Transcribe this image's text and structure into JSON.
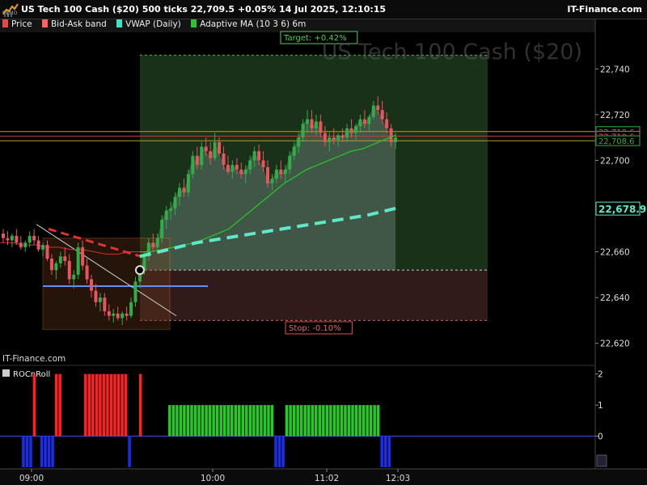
{
  "header": {
    "title": "US Tech 100 Cash ($20) 500 ticks 22,709.5 +0.05% 14 Jul 2025, 12:10:15",
    "brand": "IT-Finance.com",
    "logo_sub": "DEMO"
  },
  "legend": [
    {
      "label": "Price",
      "color": "#e24a4a"
    },
    {
      "label": "Bid-Ask band",
      "color": "#ff6060"
    },
    {
      "label": "VWAP (Daily)",
      "color": "#40e0c0"
    },
    {
      "label": "Adaptive MA (10 3 6) 6m",
      "color": "#30c030"
    }
  ],
  "watermark": "US Tech 100 Cash ($20)",
  "footer_brand": "IT-Finance.com",
  "target_label": "Target: +0.42%",
  "stop_label": "Stop: -0.10%",
  "colors": {
    "up": "#2fae47",
    "down": "#e85560",
    "vwap": "#5ee8c8",
    "ama": "#22cc22",
    "band": "#d0b030",
    "ema": "#e03030",
    "panel": "#ff2020",
    "pos": "#22cc22",
    "neg": "#1a2de8"
  },
  "chart_data": [
    {
      "type": "candlestick",
      "yaxis": {
        "ticks": [
          22740,
          22720,
          22700,
          22680,
          22660,
          22640,
          22620
        ],
        "labels": [
          "22,740",
          "22,720",
          "22,700",
          "22,680",
          "22,660",
          "22,640",
          "22,620"
        ],
        "ylim": [
          22616,
          22756
        ]
      },
      "xaxis": {
        "labels": [
          "09:00",
          "10:00",
          "11:02",
          "12:03"
        ]
      },
      "price_tags": [
        {
          "label": "22,712.6",
          "value": 22712.6,
          "color": "#2fae47"
        },
        {
          "label": "22,710.6",
          "value": 22710.6,
          "color": "#e85560"
        },
        {
          "label": "22,708.6",
          "value": 22708.6,
          "color": "#2fae47"
        },
        {
          "label": "22,678.9",
          "value": 22678.9,
          "color": "#5ee8c8"
        }
      ],
      "candles": [
        [
          22668,
          22670,
          22664,
          22666
        ],
        [
          22666,
          22669,
          22663,
          22665
        ],
        [
          22665,
          22668,
          22662,
          22667
        ],
        [
          22667,
          22670,
          22663,
          22664
        ],
        [
          22664,
          22667,
          22661,
          22662
        ],
        [
          22662,
          22665,
          22660,
          22664
        ],
        [
          22664,
          22669,
          22662,
          22667
        ],
        [
          22667,
          22670,
          22663,
          22665
        ],
        [
          22665,
          22667,
          22660,
          22661
        ],
        [
          22661,
          22664,
          22658,
          22663
        ],
        [
          22663,
          22665,
          22656,
          22657
        ],
        [
          22657,
          22659,
          22650,
          22652
        ],
        [
          22652,
          22656,
          22648,
          22655
        ],
        [
          22655,
          22660,
          22653,
          22658
        ],
        [
          22658,
          22662,
          22654,
          22656
        ],
        [
          22656,
          22659,
          22646,
          22648
        ],
        [
          22648,
          22652,
          22644,
          22650
        ],
        [
          22650,
          22664,
          22648,
          22662
        ],
        [
          22662,
          22665,
          22652,
          22654
        ],
        [
          22654,
          22657,
          22646,
          22648
        ],
        [
          22648,
          22650,
          22640,
          22643
        ],
        [
          22643,
          22646,
          22636,
          22638
        ],
        [
          22638,
          22642,
          22634,
          22640
        ],
        [
          22640,
          22642,
          22632,
          22634
        ],
        [
          22634,
          22637,
          22630,
          22632
        ],
        [
          22632,
          22635,
          22629,
          22633
        ],
        [
          22633,
          22636,
          22630,
          22631
        ],
        [
          22631,
          22634,
          22628,
          22633
        ],
        [
          22633,
          22636,
          22630,
          22632
        ],
        [
          22632,
          22640,
          22631,
          22638
        ],
        [
          22638,
          22649,
          22636,
          22647
        ],
        [
          22647,
          22654,
          22644,
          22652
        ],
        [
          22652,
          22660,
          22650,
          22658
        ],
        [
          22658,
          22666,
          22656,
          22664
        ],
        [
          22664,
          22668,
          22660,
          22662
        ],
        [
          22662,
          22668,
          22660,
          22666
        ],
        [
          22666,
          22676,
          22664,
          22674
        ],
        [
          22674,
          22680,
          22670,
          22678
        ],
        [
          22678,
          22682,
          22674,
          22679
        ],
        [
          22679,
          22686,
          22676,
          22684
        ],
        [
          22684,
          22690,
          22680,
          22688
        ],
        [
          22688,
          22692,
          22684,
          22686
        ],
        [
          22686,
          22696,
          22684,
          22694
        ],
        [
          22694,
          22704,
          22692,
          22702
        ],
        [
          22702,
          22706,
          22696,
          22698
        ],
        [
          22698,
          22708,
          22696,
          22706
        ],
        [
          22706,
          22710,
          22702,
          22704
        ],
        [
          22704,
          22708,
          22698,
          22701
        ],
        [
          22701,
          22712,
          22700,
          22708
        ],
        [
          22708,
          22710,
          22702,
          22703
        ],
        [
          22703,
          22706,
          22696,
          22698
        ],
        [
          22698,
          22702,
          22694,
          22695
        ],
        [
          22695,
          22700,
          22692,
          22698
        ],
        [
          22698,
          22701,
          22694,
          22696
        ],
        [
          22696,
          22699,
          22692,
          22694
        ],
        [
          22694,
          22698,
          22690,
          22696
        ],
        [
          22696,
          22702,
          22694,
          22700
        ],
        [
          22700,
          22706,
          22697,
          22704
        ],
        [
          22704,
          22707,
          22698,
          22700
        ],
        [
          22700,
          22704,
          22695,
          22697
        ],
        [
          22697,
          22700,
          22688,
          22690
        ],
        [
          22690,
          22694,
          22687,
          22692
        ],
        [
          22692,
          22698,
          22690,
          22696
        ],
        [
          22696,
          22700,
          22692,
          22694
        ],
        [
          22694,
          22698,
          22690,
          22696
        ],
        [
          22696,
          22704,
          22694,
          22702
        ],
        [
          22702,
          22708,
          22700,
          22706
        ],
        [
          22706,
          22712,
          22703,
          22710
        ],
        [
          22710,
          22718,
          22708,
          22716
        ],
        [
          22716,
          22722,
          22712,
          22718
        ],
        [
          22718,
          22722,
          22712,
          22714
        ],
        [
          22714,
          22720,
          22711,
          22717
        ],
        [
          22717,
          22720,
          22710,
          22712
        ],
        [
          22712,
          22715,
          22706,
          22708
        ],
        [
          22708,
          22712,
          22704,
          22710
        ],
        [
          22710,
          22714,
          22707,
          22709
        ],
        [
          22709,
          22712,
          22706,
          22711
        ],
        [
          22711,
          22714,
          22708,
          22710
        ],
        [
          22710,
          22716,
          22708,
          22714
        ],
        [
          22714,
          22718,
          22710,
          22712
        ],
        [
          22712,
          22716,
          22709,
          22715
        ],
        [
          22715,
          22720,
          22712,
          22718
        ],
        [
          22718,
          22722,
          22714,
          22716
        ],
        [
          22716,
          22720,
          22713,
          22719
        ],
        [
          22719,
          22726,
          22718,
          22724
        ],
        [
          22724,
          22728,
          22720,
          22722
        ],
        [
          22722,
          22726,
          22716,
          22718
        ],
        [
          22718,
          22721,
          22712,
          22714
        ],
        [
          22714,
          22716,
          22706,
          22708
        ],
        [
          22708,
          22712,
          22705,
          22710
        ]
      ],
      "ama_line": [
        22660,
        22660,
        22661,
        22662,
        22663,
        22664,
        22666,
        22668,
        22670,
        22674,
        22678,
        22682,
        22686,
        22690,
        22693,
        22696,
        22698,
        22700,
        22702,
        22704,
        22705,
        22707,
        22709,
        22711
      ],
      "vwap_dashed": [
        22658,
        22661,
        22664,
        22666,
        22668,
        22670,
        22672,
        22674,
        22676,
        22679
      ],
      "ema_dashed": [
        22670,
        22668,
        22666,
        22664,
        22662,
        22660,
        22658
      ],
      "bidask_line": [
        22664,
        22664,
        22663,
        22663,
        22662,
        22662,
        22661,
        22661,
        22660,
        22659,
        22659,
        22660,
        22660
      ],
      "box": {
        "top": 22666,
        "bottom": 22626
      },
      "hline": 22645,
      "target": {
        "level": 22746
      },
      "entry": {
        "value": 22652
      },
      "stop": {
        "level": 22630
      },
      "diagonal": [
        22672,
        22632
      ]
    },
    {
      "type": "bar",
      "title": "ROCnRoll",
      "yaxis": {
        "ticks": [
          2,
          1,
          0
        ],
        "labels": [
          "2",
          "1",
          "0"
        ],
        "ylim": [
          -1,
          2.2
        ]
      },
      "bars": [
        0,
        0,
        0,
        0,
        0,
        0,
        -1,
        -1,
        -1,
        2,
        0,
        -1,
        -1,
        -1,
        -1,
        2,
        2,
        0,
        0,
        0,
        0,
        0,
        0,
        2,
        2,
        2,
        2,
        2,
        2,
        2,
        2,
        2,
        2,
        2,
        2,
        -1,
        0,
        0,
        2,
        0,
        0,
        0,
        0,
        0,
        0,
        0,
        1,
        1,
        1,
        1,
        1,
        1,
        1,
        1,
        1,
        1,
        1,
        1,
        1,
        1,
        1,
        1,
        1,
        1,
        1,
        1,
        1,
        1,
        1,
        1,
        1,
        1,
        1,
        1,
        1,
        -1,
        -1,
        -1,
        1,
        1,
        1,
        1,
        1,
        1,
        1,
        1,
        1,
        1,
        1,
        1,
        1,
        1,
        1,
        1,
        1,
        1,
        1,
        1,
        1,
        1,
        1,
        1,
        1,
        1,
        -1,
        -1,
        -1,
        0,
        0
      ]
    }
  ]
}
